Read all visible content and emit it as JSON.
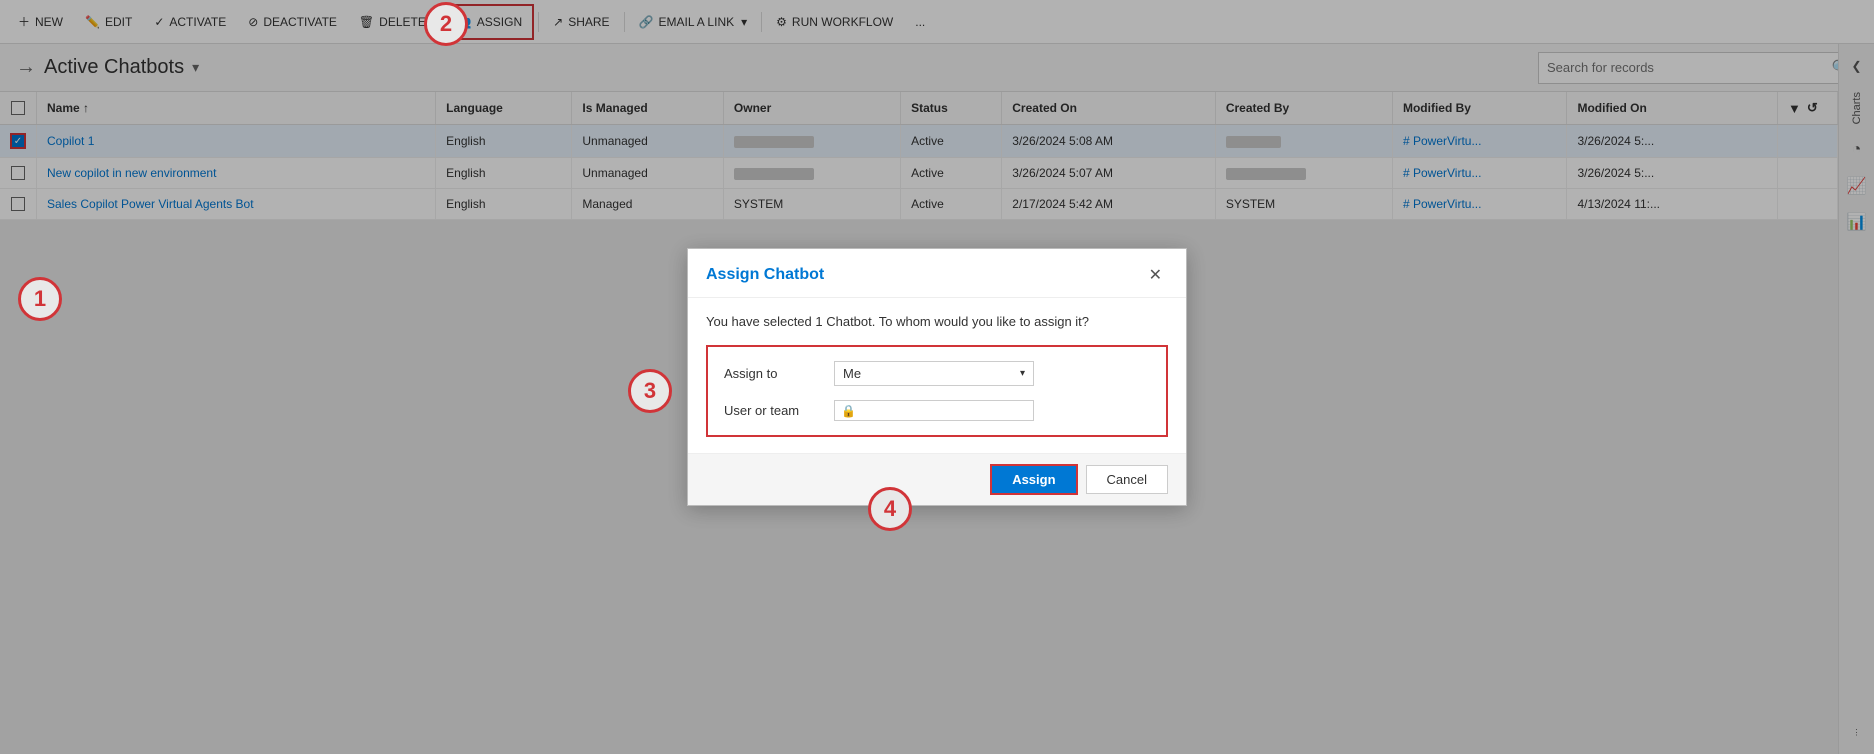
{
  "toolbar": {
    "new_label": "NEW",
    "edit_label": "EDIT",
    "activate_label": "ACTIVATE",
    "deactivate_label": "DEACTIVATE",
    "delete_label": "DELETE",
    "assign_label": "ASSIGN",
    "share_label": "SHARE",
    "email_label": "EMAIL A LINK",
    "workflow_label": "RUN WORKFLOW",
    "more_label": "..."
  },
  "header": {
    "title": "Active Chatbots",
    "search_placeholder": "Search for records"
  },
  "table": {
    "columns": [
      "",
      "Name",
      "Language",
      "Is Managed",
      "Owner",
      "Status",
      "Created On",
      "Created By",
      "Modified By",
      "Modified On"
    ],
    "rows": [
      {
        "checked": true,
        "name": "Copilot 1",
        "language": "English",
        "is_managed": "Unmanaged",
        "owner": "",
        "status": "Active",
        "created_on": "3/26/2024 5:08 AM",
        "created_by": "",
        "modified_by": "# PowerVirtu...",
        "modified_on": "3/26/2024 5:..."
      },
      {
        "checked": false,
        "name": "New copilot in new environment",
        "language": "English",
        "is_managed": "Unmanaged",
        "owner": "",
        "status": "Active",
        "created_on": "3/26/2024 5:07 AM",
        "created_by": "",
        "modified_by": "# PowerVirtu...",
        "modified_on": "3/26/2024 5:..."
      },
      {
        "checked": false,
        "name": "Sales Copilot Power Virtual Agents Bot",
        "language": "English",
        "is_managed": "Managed",
        "owner": "SYSTEM",
        "status": "Active",
        "created_on": "2/17/2024 5:42 AM",
        "created_by": "SYSTEM",
        "modified_by": "# PowerVirtu...",
        "modified_on": "4/13/2024 11:..."
      }
    ]
  },
  "modal": {
    "title": "Assign Chatbot",
    "description": "You have selected 1 Chatbot. To whom would you like to assign it?",
    "assign_to_label": "Assign to",
    "assign_to_value": "Me",
    "user_team_label": "User or team",
    "user_team_value": "",
    "assign_button": "Assign",
    "cancel_button": "Cancel"
  },
  "sidebar": {
    "charts_label": "Charts",
    "icons": [
      "chevron-left",
      "funnel",
      "refresh",
      "pie-chart",
      "bar-chart"
    ]
  },
  "annotations": [
    "1",
    "2",
    "3",
    "4"
  ]
}
